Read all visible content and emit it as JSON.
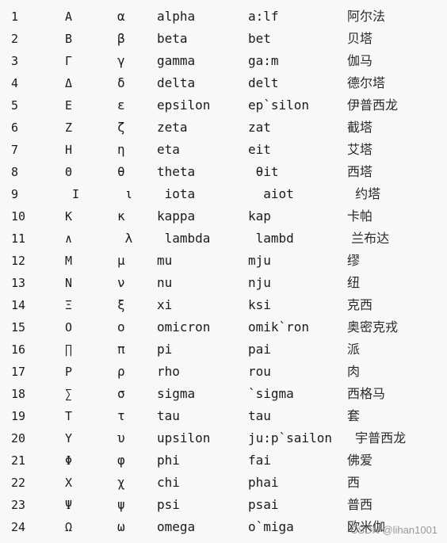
{
  "rows": [
    {
      "num": "1",
      "upper": "Α",
      "lower": "α",
      "name": "alpha",
      "pron": "a:lf",
      "cn": "阿尔法"
    },
    {
      "num": "2",
      "upper": "Β",
      "lower": "β",
      "name": "beta",
      "pron": "bet",
      "cn": "贝塔"
    },
    {
      "num": "3",
      "upper": "Γ",
      "lower": "γ",
      "name": "gamma",
      "pron": "ga:m",
      "cn": "伽马"
    },
    {
      "num": "4",
      "upper": "Δ",
      "lower": "δ",
      "name": "delta",
      "pron": "delt",
      "cn": "德尔塔"
    },
    {
      "num": "5",
      "upper": "Ε",
      "lower": "ε",
      "name": "epsilon",
      "pron": "ep`silon",
      "cn": "伊普西龙"
    },
    {
      "num": "6",
      "upper": "Ζ",
      "lower": "ζ",
      "name": "zeta",
      "pron": "zat",
      "cn": "截塔"
    },
    {
      "num": "7",
      "upper": "Η",
      "lower": "η",
      "name": "eta",
      "pron": "eit",
      "cn": "艾塔"
    },
    {
      "num": "8",
      "upper": "Θ",
      "lower": "θ",
      "name": "theta",
      "pron": " θit",
      "cn": "西塔"
    },
    {
      "num": "9",
      "upper": " Ι",
      "lower": " ι",
      "name": " iota",
      "pron": "  aiot",
      "cn": "  约塔"
    },
    {
      "num": "10",
      "upper": "Κ",
      "lower": "κ",
      "name": "kappa",
      "pron": "kap",
      "cn": "卡帕"
    },
    {
      "num": "11",
      "upper": "∧",
      "lower": " λ",
      "name": " lambda",
      "pron": " lambd",
      "cn": " 兰布达"
    },
    {
      "num": "12",
      "upper": "Μ",
      "lower": "μ",
      "name": "mu",
      "pron": "mju",
      "cn": "缪"
    },
    {
      "num": "13",
      "upper": "Ν",
      "lower": "ν",
      "name": "nu",
      "pron": "nju",
      "cn": "纽"
    },
    {
      "num": "14",
      "upper": "Ξ",
      "lower": "ξ",
      "name": "xi",
      "pron": "ksi",
      "cn": "克西"
    },
    {
      "num": "15",
      "upper": "Ο",
      "lower": "ο",
      "name": "omicron",
      "pron": "omik`ron",
      "cn": "奥密克戎"
    },
    {
      "num": "16",
      "upper": "∏",
      "lower": "π",
      "name": "pi",
      "pron": "pai",
      "cn": "派"
    },
    {
      "num": "17",
      "upper": "Ρ",
      "lower": "ρ",
      "name": "rho",
      "pron": "rou",
      "cn": "肉"
    },
    {
      "num": "18",
      "upper": "∑",
      "lower": "σ",
      "name": "sigma",
      "pron": "`sigma",
      "cn": "西格马"
    },
    {
      "num": "19",
      "upper": "Τ",
      "lower": "τ",
      "name": "tau",
      "pron": "tau",
      "cn": "套"
    },
    {
      "num": "20",
      "upper": "Υ",
      "lower": "υ",
      "name": "upsilon",
      "pron": "ju:p`sailon",
      "cn": "  宇普西龙"
    },
    {
      "num": "21",
      "upper": "Φ",
      "lower": "φ",
      "name": "phi",
      "pron": "fai",
      "cn": "佛爱"
    },
    {
      "num": "22",
      "upper": "Χ",
      "lower": "χ",
      "name": "chi",
      "pron": "phai",
      "cn": "西"
    },
    {
      "num": "23",
      "upper": "Ψ",
      "lower": "ψ",
      "name": "psi",
      "pron": "psai",
      "cn": "普西"
    },
    {
      "num": "24",
      "upper": "Ω",
      "lower": "ω",
      "name": "omega",
      "pron": "o`miga",
      "cn": "欧米伽"
    }
  ],
  "watermark": "CSDN @lihan1001"
}
